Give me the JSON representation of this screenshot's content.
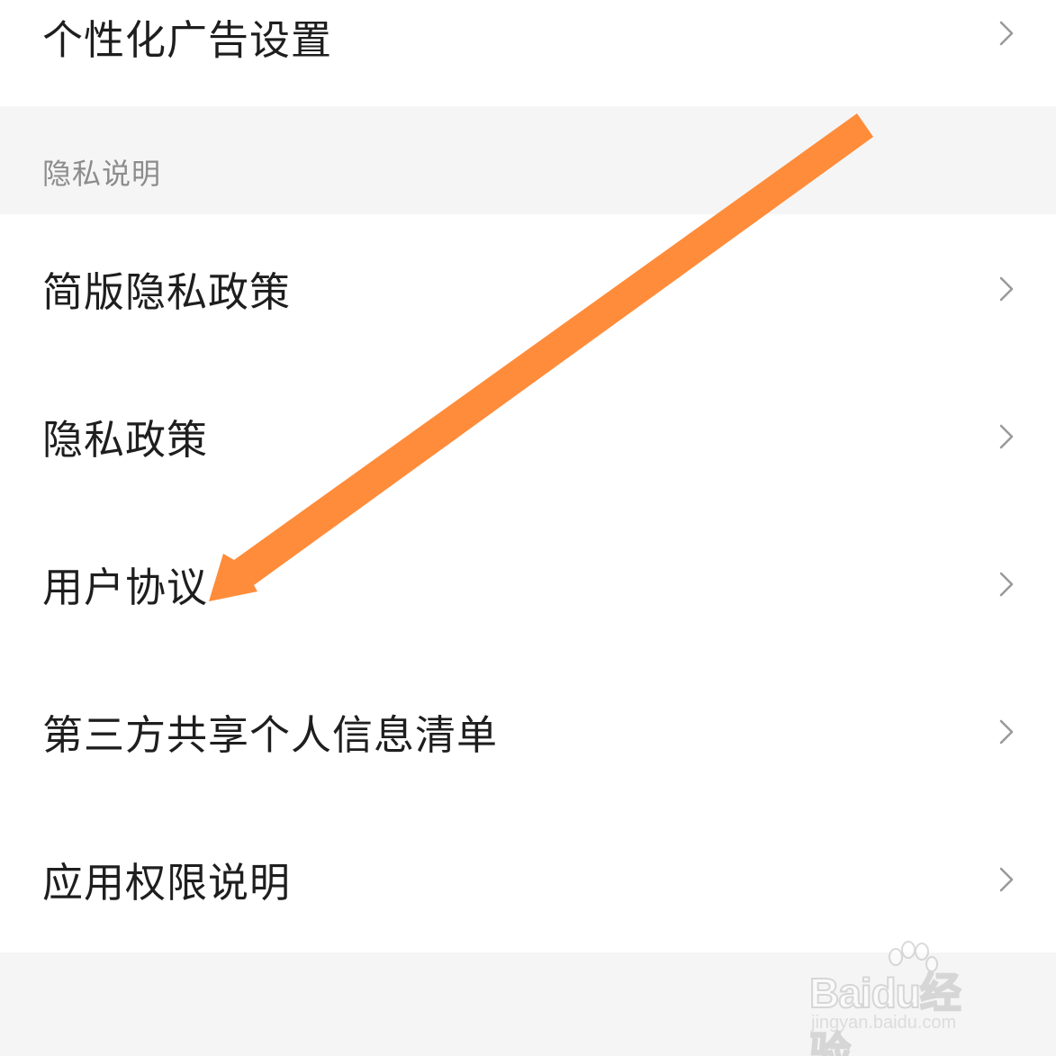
{
  "settings": {
    "top_item": {
      "label": "个性化广告设置"
    },
    "section_title": "隐私说明",
    "items": [
      {
        "label": "简版隐私政策"
      },
      {
        "label": "隐私政策"
      },
      {
        "label": "用户协议"
      },
      {
        "label": "第三方共享个人信息清单"
      },
      {
        "label": "应用权限说明"
      }
    ]
  },
  "annotation": {
    "arrow_color": "#ff8c3a",
    "arrow_target": "用户协议"
  },
  "watermark": {
    "brand": "Baidu经验",
    "url": "jingyan.baidu.com"
  },
  "icons": {
    "row_chevron": "chevron-right-icon",
    "watermark_logo": "paw-icon"
  },
  "colors": {
    "background": "#f5f5f5",
    "row_background": "#ffffff",
    "label_text": "#1e1e1e",
    "section_text": "#8c8c8c",
    "chevron": "#9a9a9a"
  }
}
